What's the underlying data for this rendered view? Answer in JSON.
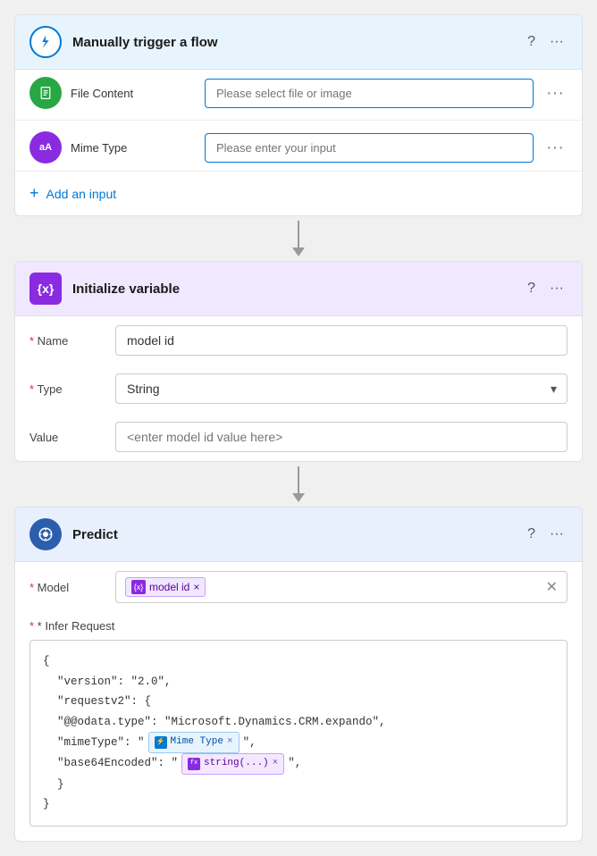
{
  "trigger": {
    "title": "Manually trigger a flow",
    "icon": "⚡",
    "inputs": [
      {
        "id": "file-content",
        "label": "File Content",
        "placeholder": "Please select file or image",
        "icon": "📄",
        "icon_color": "#28a745"
      },
      {
        "id": "mime-type",
        "label": "Mime Type",
        "placeholder": "Please enter your input",
        "icon": "aA",
        "icon_color": "#8a2be2"
      }
    ],
    "add_input_label": "Add an input"
  },
  "variable": {
    "title": "Initialize variable",
    "name_label": "* Name",
    "name_value": "model id",
    "type_label": "* Type",
    "type_value": "String",
    "value_label": "Value",
    "value_placeholder": "<enter model id value here>"
  },
  "predict": {
    "title": "Predict",
    "model_label": "* Model",
    "model_chip_label": "model id",
    "infer_label": "* Infer Request",
    "json_lines": [
      {
        "indent": 0,
        "text": "{"
      },
      {
        "indent": 1,
        "text": "\"version\": \"2.0\","
      },
      {
        "indent": 1,
        "text": "\"requestv2\": {"
      },
      {
        "indent": 1,
        "text": "\"@@odata.type\": \"Microsoft.Dynamics.CRM.expando\","
      },
      {
        "indent": 1,
        "text": "\"mimeType\": \""
      },
      {
        "indent": 1,
        "text": "\"base64Encoded\": \""
      },
      {
        "indent": 1,
        "text": "}"
      },
      {
        "indent": 0,
        "text": "}"
      }
    ],
    "mime_chip_label": "Mime Type",
    "string_chip_label": "string(...)"
  }
}
